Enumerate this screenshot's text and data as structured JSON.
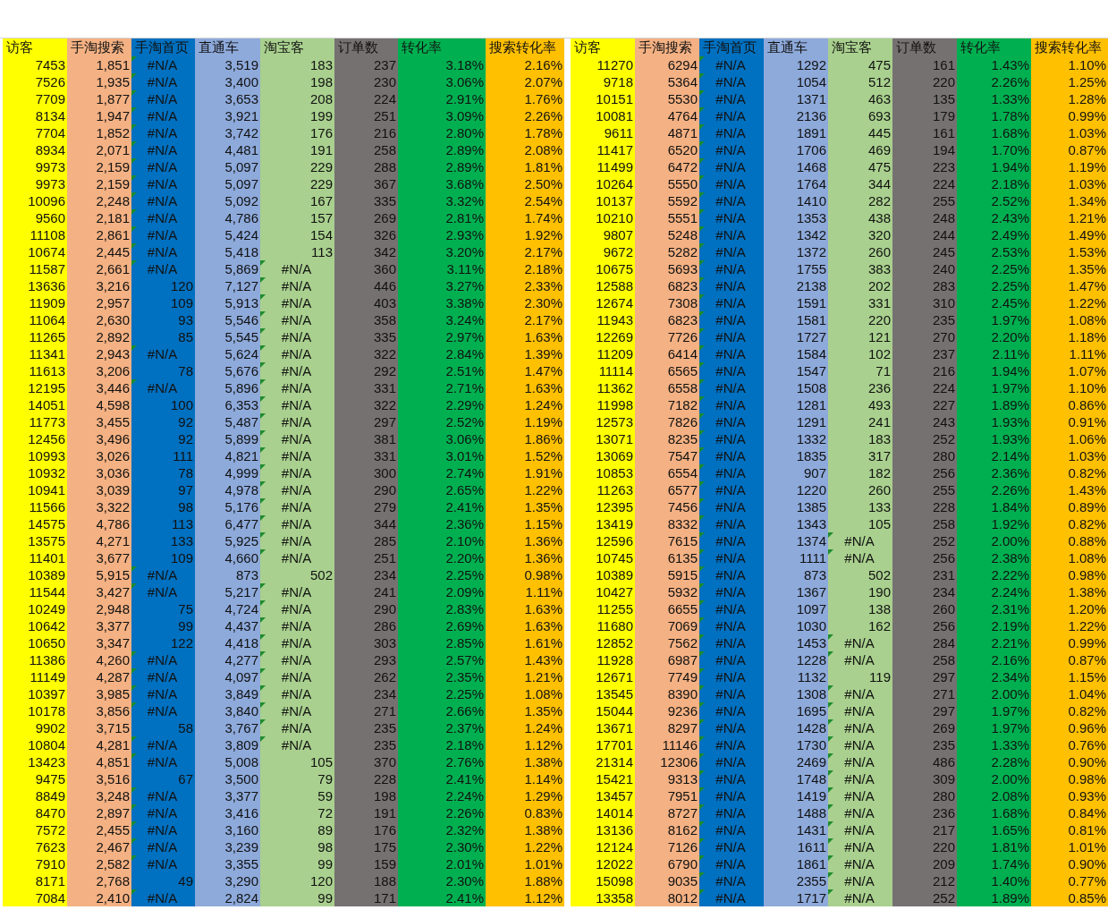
{
  "tables": [
    {
      "columns": [
        {
          "label": "访客",
          "color": "#ffff00"
        },
        {
          "label": "手淘搜索",
          "color": "#f4b183"
        },
        {
          "label": "手淘首页",
          "color": "#0070c0"
        },
        {
          "label": "直通车",
          "color": "#8eaadb"
        },
        {
          "label": "淘宝客",
          "color": "#a9d08e"
        },
        {
          "label": "订单数",
          "color": "#767171"
        },
        {
          "label": "转化率",
          "color": "#00b050"
        },
        {
          "label": "搜索转化率",
          "color": "#ffc000"
        }
      ],
      "rows": [
        [
          "7453",
          "1,851",
          {
            "text": "#N/A",
            "error": true
          },
          "3,519",
          "183",
          "237",
          "3.18%",
          "2.16%"
        ],
        [
          "7526",
          "1,935",
          {
            "text": "#N/A",
            "error": true
          },
          "3,400",
          "198",
          "230",
          "3.06%",
          "2.07%"
        ],
        [
          "7709",
          "1,877",
          {
            "text": "#N/A",
            "error": true
          },
          "3,653",
          "208",
          "224",
          "2.91%",
          "1.76%"
        ],
        [
          "8134",
          "1,947",
          {
            "text": "#N/A",
            "error": true
          },
          "3,921",
          "199",
          "251",
          "3.09%",
          "2.26%"
        ],
        [
          "7704",
          "1,852",
          {
            "text": "#N/A",
            "error": true
          },
          "3,742",
          "176",
          "216",
          "2.80%",
          "1.78%"
        ],
        [
          "8934",
          "2,071",
          {
            "text": "#N/A",
            "error": true
          },
          "4,481",
          "191",
          "258",
          "2.89%",
          "2.08%"
        ],
        [
          "9973",
          "2,159",
          {
            "text": "#N/A",
            "error": true
          },
          "5,097",
          "229",
          "288",
          "2.89%",
          "1.81%"
        ],
        [
          "9973",
          "2,159",
          {
            "text": "#N/A",
            "error": true
          },
          "5,097",
          "229",
          "367",
          "3.68%",
          "2.50%"
        ],
        [
          "10096",
          "2,248",
          {
            "text": "#N/A",
            "error": true
          },
          "5,092",
          "167",
          "335",
          "3.32%",
          "2.54%"
        ],
        [
          "9560",
          "2,181",
          {
            "text": "#N/A",
            "error": true
          },
          "4,786",
          "157",
          "269",
          "2.81%",
          "1.74%"
        ],
        [
          "11108",
          "2,861",
          {
            "text": "#N/A",
            "error": true
          },
          "5,424",
          "154",
          "326",
          "2.93%",
          "1.92%"
        ],
        [
          "10674",
          "2,445",
          {
            "text": "#N/A",
            "error": true
          },
          "5,418",
          "113",
          "342",
          "3.20%",
          "2.17%"
        ],
        [
          "11587",
          "2,661",
          {
            "text": "#N/A",
            "error": true
          },
          "5,869",
          {
            "text": "#N/A",
            "error": true
          },
          "360",
          "3.11%",
          "2.18%"
        ],
        [
          "13636",
          "3,216",
          "120",
          "7,127",
          {
            "text": "#N/A",
            "error": true
          },
          "446",
          "3.27%",
          "2.33%"
        ],
        [
          "11909",
          "2,957",
          "109",
          "5,913",
          {
            "text": "#N/A",
            "error": true
          },
          "403",
          "3.38%",
          "2.30%"
        ],
        [
          "11064",
          "2,630",
          "93",
          "5,546",
          {
            "text": "#N/A",
            "error": true
          },
          "358",
          "3.24%",
          "2.17%"
        ],
        [
          "11265",
          "2,892",
          "85",
          "5,545",
          {
            "text": "#N/A",
            "error": true
          },
          "335",
          "2.97%",
          "1.63%"
        ],
        [
          "11341",
          "2,943",
          {
            "text": "#N/A",
            "error": true
          },
          "5,624",
          {
            "text": "#N/A",
            "error": true
          },
          "322",
          "2.84%",
          "1.39%"
        ],
        [
          "11613",
          "3,206",
          "78",
          "5,676",
          {
            "text": "#N/A",
            "error": true
          },
          "292",
          "2.51%",
          "1.47%"
        ],
        [
          "12195",
          "3,446",
          {
            "text": "#N/A",
            "error": true
          },
          "5,896",
          {
            "text": "#N/A",
            "error": true
          },
          "331",
          "2.71%",
          "1.63%"
        ],
        [
          "14051",
          "4,598",
          "100",
          "6,353",
          {
            "text": "#N/A",
            "error": true
          },
          "322",
          "2.29%",
          "1.24%"
        ],
        [
          "11773",
          "3,455",
          "92",
          "5,487",
          {
            "text": "#N/A",
            "error": true
          },
          "297",
          "2.52%",
          "1.19%"
        ],
        [
          "12456",
          "3,496",
          "92",
          "5,899",
          {
            "text": "#N/A",
            "error": true
          },
          "381",
          "3.06%",
          "1.86%"
        ],
        [
          "10993",
          "3,026",
          "111",
          "4,821",
          {
            "text": "#N/A",
            "error": true
          },
          "331",
          "3.01%",
          "1.52%"
        ],
        [
          "10932",
          "3,036",
          "78",
          "4,999",
          {
            "text": "#N/A",
            "error": true
          },
          "300",
          "2.74%",
          "1.91%"
        ],
        [
          "10941",
          "3,039",
          "97",
          "4,978",
          {
            "text": "#N/A",
            "error": true
          },
          "290",
          "2.65%",
          "1.22%"
        ],
        [
          "11566",
          "3,322",
          "98",
          "5,176",
          {
            "text": "#N/A",
            "error": true
          },
          "279",
          "2.41%",
          "1.35%"
        ],
        [
          "14575",
          "4,786",
          "113",
          "6,477",
          {
            "text": "#N/A",
            "error": true
          },
          "344",
          "2.36%",
          "1.15%"
        ],
        [
          "13575",
          "4,271",
          "133",
          "5,925",
          {
            "text": "#N/A",
            "error": true
          },
          "285",
          "2.10%",
          "1.36%"
        ],
        [
          "11401",
          "3,677",
          "109",
          "4,660",
          {
            "text": "#N/A",
            "error": true
          },
          "251",
          "2.20%",
          "1.36%"
        ],
        [
          "10389",
          "5,915",
          {
            "text": "#N/A",
            "error": true
          },
          "873",
          "502",
          "234",
          "2.25%",
          "0.98%"
        ],
        [
          "11544",
          "3,427",
          {
            "text": "#N/A",
            "error": true
          },
          "5,217",
          {
            "text": "#N/A",
            "error": true
          },
          "241",
          "2.09%",
          "1.11%"
        ],
        [
          "10249",
          "2,948",
          "75",
          "4,724",
          {
            "text": "#N/A",
            "error": true
          },
          "290",
          "2.83%",
          "1.63%"
        ],
        [
          "10642",
          "3,377",
          "99",
          "4,437",
          {
            "text": "#N/A",
            "error": true
          },
          "286",
          "2.69%",
          "1.63%"
        ],
        [
          "10650",
          "3,347",
          "122",
          "4,418",
          {
            "text": "#N/A",
            "error": true
          },
          "303",
          "2.85%",
          "1.61%"
        ],
        [
          "11386",
          "4,260",
          {
            "text": "#N/A",
            "error": true
          },
          "4,277",
          {
            "text": "#N/A",
            "error": true
          },
          "293",
          "2.57%",
          "1.43%"
        ],
        [
          "11149",
          "4,287",
          {
            "text": "#N/A",
            "error": true
          },
          "4,097",
          {
            "text": "#N/A",
            "error": true
          },
          "262",
          "2.35%",
          "1.21%"
        ],
        [
          "10397",
          "3,985",
          {
            "text": "#N/A",
            "error": true
          },
          "3,849",
          {
            "text": "#N/A",
            "error": true
          },
          "234",
          "2.25%",
          "1.08%"
        ],
        [
          "10178",
          "3,856",
          {
            "text": "#N/A",
            "error": true
          },
          "3,840",
          {
            "text": "#N/A",
            "error": true
          },
          "271",
          "2.66%",
          "1.35%"
        ],
        [
          "9902",
          "3,715",
          "58",
          "3,767",
          {
            "text": "#N/A",
            "error": true
          },
          "235",
          "2.37%",
          "1.24%"
        ],
        [
          "10804",
          "4,281",
          {
            "text": "#N/A",
            "error": true
          },
          "3,809",
          {
            "text": "#N/A",
            "error": true
          },
          "235",
          "2.18%",
          "1.12%"
        ],
        [
          "13423",
          "4,851",
          {
            "text": "#N/A",
            "error": true
          },
          "5,008",
          "105",
          "370",
          "2.76%",
          "1.38%"
        ],
        [
          "9475",
          "3,516",
          "67",
          "3,500",
          "79",
          "228",
          "2.41%",
          "1.14%"
        ],
        [
          "8849",
          "3,248",
          {
            "text": "#N/A",
            "error": true
          },
          "3,377",
          "59",
          "198",
          "2.24%",
          "1.29%"
        ],
        [
          "8470",
          "2,897",
          {
            "text": "#N/A",
            "error": true
          },
          "3,416",
          "72",
          "191",
          "2.26%",
          "0.83%"
        ],
        [
          "7572",
          "2,455",
          {
            "text": "#N/A",
            "error": true
          },
          "3,160",
          "89",
          "176",
          "2.32%",
          "1.38%"
        ],
        [
          "7623",
          "2,467",
          {
            "text": "#N/A",
            "error": true
          },
          "3,239",
          "98",
          "175",
          "2.30%",
          "1.22%"
        ],
        [
          "7910",
          "2,582",
          {
            "text": "#N/A",
            "error": true
          },
          "3,355",
          "99",
          "159",
          "2.01%",
          "1.01%"
        ],
        [
          "8171",
          "2,768",
          "49",
          "3,290",
          "120",
          "188",
          "2.30%",
          "1.88%"
        ],
        [
          "7084",
          "2,410",
          {
            "text": "#N/A",
            "error": true
          },
          "2,824",
          "99",
          "171",
          "2.41%",
          "1.12%"
        ]
      ]
    },
    {
      "columns": [
        {
          "label": "访客",
          "color": "#ffff00"
        },
        {
          "label": "手淘搜索",
          "color": "#f4b183"
        },
        {
          "label": "手淘首页",
          "color": "#0070c0"
        },
        {
          "label": "直通车",
          "color": "#8eaadb"
        },
        {
          "label": "淘宝客",
          "color": "#a9d08e"
        },
        {
          "label": "订单数",
          "color": "#767171"
        },
        {
          "label": "转化率",
          "color": "#00b050"
        },
        {
          "label": "搜索转化率",
          "color": "#ffc000"
        }
      ],
      "rows": [
        [
          "11270",
          "6294",
          {
            "text": "#N/A",
            "error": true
          },
          "1292",
          "475",
          "161",
          "1.43%",
          "1.10%"
        ],
        [
          "9718",
          "5364",
          {
            "text": "#N/A",
            "error": true
          },
          "1054",
          "512",
          "220",
          "2.26%",
          "1.25%"
        ],
        [
          "10151",
          "5530",
          {
            "text": "#N/A",
            "error": true
          },
          "1371",
          "463",
          "135",
          "1.33%",
          "1.28%"
        ],
        [
          "10081",
          "4764",
          {
            "text": "#N/A",
            "error": true
          },
          "2136",
          "693",
          "179",
          "1.78%",
          "0.99%"
        ],
        [
          "9611",
          "4871",
          {
            "text": "#N/A",
            "error": true
          },
          "1891",
          "445",
          "161",
          "1.68%",
          "1.03%"
        ],
        [
          "11417",
          "6520",
          {
            "text": "#N/A",
            "error": true
          },
          "1706",
          "469",
          "194",
          "1.70%",
          "0.87%"
        ],
        [
          "11499",
          "6472",
          {
            "text": "#N/A",
            "error": true
          },
          "1468",
          "475",
          "223",
          "1.94%",
          "1.19%"
        ],
        [
          "10264",
          "5550",
          {
            "text": "#N/A",
            "error": true
          },
          "1764",
          "344",
          "224",
          "2.18%",
          "1.03%"
        ],
        [
          "10137",
          "5592",
          {
            "text": "#N/A",
            "error": true
          },
          "1410",
          "282",
          "255",
          "2.52%",
          "1.34%"
        ],
        [
          "10210",
          "5551",
          {
            "text": "#N/A",
            "error": true
          },
          "1353",
          "438",
          "248",
          "2.43%",
          "1.21%"
        ],
        [
          "9807",
          "5248",
          {
            "text": "#N/A",
            "error": true
          },
          "1342",
          "320",
          "244",
          "2.49%",
          "1.49%"
        ],
        [
          "9672",
          "5282",
          {
            "text": "#N/A",
            "error": true
          },
          "1372",
          "260",
          "245",
          "2.53%",
          "1.53%"
        ],
        [
          "10675",
          "5693",
          {
            "text": "#N/A",
            "error": true
          },
          "1755",
          "383",
          "240",
          "2.25%",
          "1.35%"
        ],
        [
          "12588",
          "6823",
          {
            "text": "#N/A",
            "error": true
          },
          "2138",
          "202",
          "283",
          "2.25%",
          "1.47%"
        ],
        [
          "12674",
          "7308",
          {
            "text": "#N/A",
            "error": true
          },
          "1591",
          "331",
          "310",
          "2.45%",
          "1.22%"
        ],
        [
          "11943",
          "6823",
          {
            "text": "#N/A",
            "error": true
          },
          "1581",
          "220",
          "235",
          "1.97%",
          "1.08%"
        ],
        [
          "12269",
          "7726",
          {
            "text": "#N/A",
            "error": true
          },
          "1727",
          "121",
          "270",
          "2.20%",
          "1.18%"
        ],
        [
          "11209",
          "6414",
          {
            "text": "#N/A",
            "error": true
          },
          "1584",
          "102",
          "237",
          "2.11%",
          "1.11%"
        ],
        [
          "11114",
          "6565",
          {
            "text": "#N/A",
            "error": true
          },
          "1547",
          "71",
          "216",
          "1.94%",
          "1.07%"
        ],
        [
          "11362",
          "6558",
          {
            "text": "#N/A",
            "error": true
          },
          "1508",
          "236",
          "224",
          "1.97%",
          "1.10%"
        ],
        [
          "11998",
          "7182",
          {
            "text": "#N/A",
            "error": true
          },
          "1281",
          "493",
          "227",
          "1.89%",
          "0.86%"
        ],
        [
          "12573",
          "7826",
          {
            "text": "#N/A",
            "error": true
          },
          "1291",
          "241",
          "243",
          "1.93%",
          "0.91%"
        ],
        [
          "13071",
          "8235",
          {
            "text": "#N/A",
            "error": true
          },
          "1332",
          "183",
          "252",
          "1.93%",
          "1.06%"
        ],
        [
          "13069",
          "7547",
          {
            "text": "#N/A",
            "error": true
          },
          "1835",
          "317",
          "280",
          "2.14%",
          "1.03%"
        ],
        [
          "10853",
          "6554",
          {
            "text": "#N/A",
            "error": true
          },
          "907",
          "182",
          "256",
          "2.36%",
          "0.82%"
        ],
        [
          "11263",
          "6577",
          {
            "text": "#N/A",
            "error": true
          },
          "1220",
          "260",
          "255",
          "2.26%",
          "1.43%"
        ],
        [
          "12395",
          "7456",
          {
            "text": "#N/A",
            "error": true
          },
          "1385",
          "133",
          "228",
          "1.84%",
          "0.89%"
        ],
        [
          "13419",
          "8332",
          {
            "text": "#N/A",
            "error": true
          },
          "1343",
          "105",
          "258",
          "1.92%",
          "0.82%"
        ],
        [
          "12596",
          "7615",
          {
            "text": "#N/A",
            "error": true
          },
          "1374",
          {
            "text": "#N/A",
            "error": true
          },
          "252",
          "2.00%",
          "0.88%"
        ],
        [
          "10745",
          "6135",
          {
            "text": "#N/A",
            "error": true
          },
          "1111",
          {
            "text": "#N/A",
            "error": true
          },
          "256",
          "2.38%",
          "1.08%"
        ],
        [
          "10389",
          "5915",
          {
            "text": "#N/A",
            "error": true
          },
          "873",
          "502",
          "231",
          "2.22%",
          "0.98%"
        ],
        [
          "10427",
          "5932",
          {
            "text": "#N/A",
            "error": true
          },
          "1367",
          "190",
          "234",
          "2.24%",
          "1.38%"
        ],
        [
          "11255",
          "6655",
          {
            "text": "#N/A",
            "error": true
          },
          "1097",
          "138",
          "260",
          "2.31%",
          "1.20%"
        ],
        [
          "11680",
          "7069",
          {
            "text": "#N/A",
            "error": true
          },
          "1030",
          "162",
          "256",
          "2.19%",
          "1.22%"
        ],
        [
          "12852",
          "7562",
          {
            "text": "#N/A",
            "error": true
          },
          "1453",
          {
            "text": "#N/A",
            "error": true
          },
          "284",
          "2.21%",
          "0.99%"
        ],
        [
          "11928",
          "6987",
          {
            "text": "#N/A",
            "error": true
          },
          "1228",
          {
            "text": "#N/A",
            "error": true
          },
          "258",
          "2.16%",
          "0.87%"
        ],
        [
          "12671",
          "7749",
          {
            "text": "#N/A",
            "error": true
          },
          "1132",
          "119",
          "297",
          "2.34%",
          "1.15%"
        ],
        [
          "13545",
          "8390",
          {
            "text": "#N/A",
            "error": true
          },
          "1308",
          {
            "text": "#N/A",
            "error": true
          },
          "271",
          "2.00%",
          "1.04%"
        ],
        [
          "15044",
          "9236",
          {
            "text": "#N/A",
            "error": true
          },
          "1695",
          {
            "text": "#N/A",
            "error": true
          },
          "297",
          "1.97%",
          "0.82%"
        ],
        [
          "13671",
          "8297",
          {
            "text": "#N/A",
            "error": true
          },
          "1428",
          {
            "text": "#N/A",
            "error": true
          },
          "269",
          "1.97%",
          "0.96%"
        ],
        [
          "17701",
          "11146",
          {
            "text": "#N/A",
            "error": true
          },
          "1730",
          {
            "text": "#N/A",
            "error": true
          },
          "235",
          "1.33%",
          "0.76%"
        ],
        [
          "21314",
          "12306",
          {
            "text": "#N/A",
            "error": true
          },
          "2469",
          {
            "text": "#N/A",
            "error": true
          },
          "486",
          "2.28%",
          "0.90%"
        ],
        [
          "15421",
          "9313",
          {
            "text": "#N/A",
            "error": true
          },
          "1748",
          {
            "text": "#N/A",
            "error": true
          },
          "309",
          "2.00%",
          "0.98%"
        ],
        [
          "13457",
          "7951",
          {
            "text": "#N/A",
            "error": true
          },
          "1419",
          {
            "text": "#N/A",
            "error": true
          },
          "280",
          "2.08%",
          "0.93%"
        ],
        [
          "14014",
          "8727",
          {
            "text": "#N/A",
            "error": true
          },
          "1488",
          {
            "text": "#N/A",
            "error": true
          },
          "236",
          "1.68%",
          "0.84%"
        ],
        [
          "13136",
          "8162",
          {
            "text": "#N/A",
            "error": true
          },
          "1431",
          {
            "text": "#N/A",
            "error": true
          },
          "217",
          "1.65%",
          "0.81%"
        ],
        [
          "12124",
          "7126",
          {
            "text": "#N/A",
            "error": true
          },
          "1611",
          {
            "text": "#N/A",
            "error": true
          },
          "220",
          "1.81%",
          "1.01%"
        ],
        [
          "12022",
          "6790",
          {
            "text": "#N/A",
            "error": true
          },
          "1861",
          {
            "text": "#N/A",
            "error": true
          },
          "209",
          "1.74%",
          "0.90%"
        ],
        [
          "15098",
          "9035",
          {
            "text": "#N/A",
            "error": true
          },
          "2355",
          {
            "text": "#N/A",
            "error": true
          },
          "212",
          "1.40%",
          "0.77%"
        ],
        [
          "13358",
          "8012",
          {
            "text": "#N/A",
            "error": true
          },
          "1717",
          {
            "text": "#N/A",
            "error": true
          },
          "252",
          "1.89%",
          "0.85%"
        ]
      ]
    }
  ]
}
